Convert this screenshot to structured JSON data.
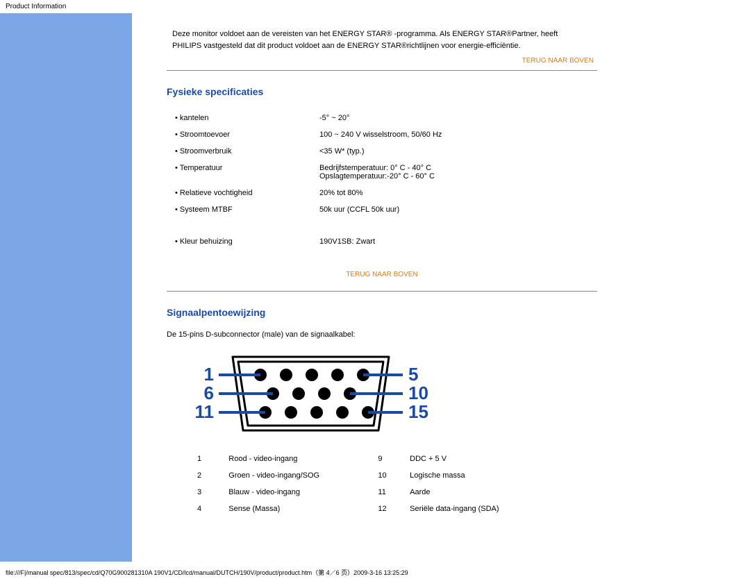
{
  "header": "Product Information",
  "intro": {
    "line1": "Deze monitor voldoet aan de vereisten van het ENERGY STAR® -programma. Als ENERGY STAR®Partner, heeft",
    "line2": "PHILIPS vastgesteld dat dit product voldoet aan de ENERGY STAR®richtlijnen voor energie-efficiëntie."
  },
  "to_top": "TERUG NAAR BOVEN",
  "section_specs": "Fysieke specificaties",
  "specs": [
    {
      "label": "• kantelen",
      "value": "-5° ~ 20°"
    },
    {
      "label": "• Stroomtoevoer",
      "value": "100 ~ 240 V wisselstroom, 50/60 Hz"
    },
    {
      "label": "• Stroomverbruik",
      "value": "<35 W* (typ.)"
    },
    {
      "label": "• Temperatuur",
      "value": "Bedrijfstemperatuur: 0° C - 40° C\nOpslagtemperatuur:-20° C - 60° C"
    },
    {
      "label": "• Relatieve vochtigheid",
      "value": "20% tot 80%"
    },
    {
      "label": "• Systeem MTBF",
      "value": "50k uur (CCFL 50k uur)"
    },
    {
      "label": "• Kleur behuizing",
      "value": "190V1SB: Zwart"
    }
  ],
  "section_pins": "Signaalpentoewijzing",
  "pins_intro": "De 15-pins D-subconnector (male) van de signaalkabel:",
  "connector_labels": {
    "one": "1",
    "five": "5",
    "six": "6",
    "ten": "10",
    "eleven": "11",
    "fifteen": "15"
  },
  "pin_table": [
    {
      "n1": "1",
      "d1": "Rood - video-ingang",
      "n2": "9",
      "d2": "DDC + 5 V"
    },
    {
      "n1": "2",
      "d1": "Groen - video-ingang/SOG",
      "n2": "10",
      "d2": "Logische massa"
    },
    {
      "n1": "3",
      "d1": "Blauw - video-ingang",
      "n2": "11",
      "d2": "Aarde"
    },
    {
      "n1": "4",
      "d1": "Sense (Massa)",
      "n2": "12",
      "d2": "Seriële data-ingang (SDA)"
    }
  ],
  "footer": "file:///F|/manual spec/813/spec/cd/Q70G900281310A 190V1/CD/lcd/manual/DUTCH/190V/product/product.htm（第 4／6 页）2009-3-16 13:25:29"
}
